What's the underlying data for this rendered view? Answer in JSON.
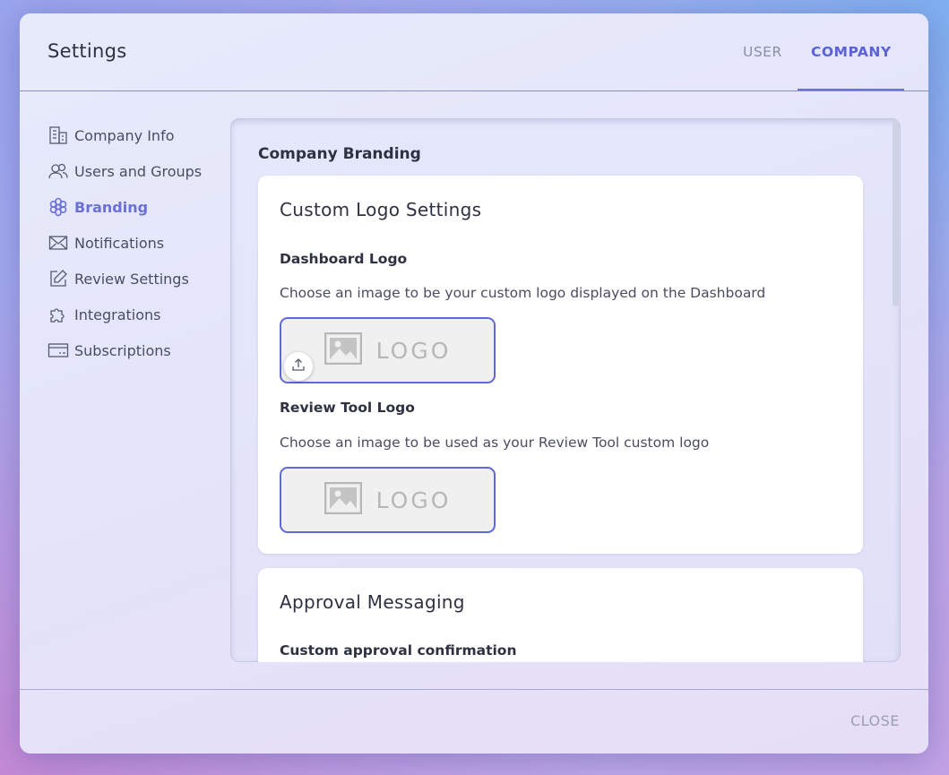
{
  "header": {
    "title": "Settings",
    "tabs": [
      {
        "label": "USER",
        "active": false
      },
      {
        "label": "COMPANY",
        "active": true
      }
    ]
  },
  "sidebar": {
    "items": [
      {
        "label": "Company Info",
        "icon": "building-icon",
        "active": false
      },
      {
        "label": "Users and Groups",
        "icon": "users-icon",
        "active": false
      },
      {
        "label": "Branding",
        "icon": "flower-icon",
        "active": true
      },
      {
        "label": "Notifications",
        "icon": "envelope-icon",
        "active": false
      },
      {
        "label": "Review Settings",
        "icon": "edit-icon",
        "active": false
      },
      {
        "label": "Integrations",
        "icon": "puzzle-icon",
        "active": false
      },
      {
        "label": "Subscriptions",
        "icon": "card-icon",
        "active": false
      }
    ]
  },
  "main": {
    "heading": "Company Branding",
    "custom_logo": {
      "title": "Custom Logo Settings",
      "dashboard": {
        "label": "Dashboard Logo",
        "description": "Choose an image to be your custom logo displayed on the Dashboard",
        "placeholder": "LOGO"
      },
      "review_tool": {
        "label": "Review Tool Logo",
        "description": "Choose an image to be used as your Review Tool custom logo",
        "placeholder": "LOGO"
      }
    },
    "approval": {
      "title": "Approval Messaging",
      "field_label": "Custom approval confirmation"
    }
  },
  "footer": {
    "close_label": "CLOSE"
  },
  "colors": {
    "accent": "#5a62d6",
    "text": "#2e3142",
    "muted": "#8a8da6"
  }
}
